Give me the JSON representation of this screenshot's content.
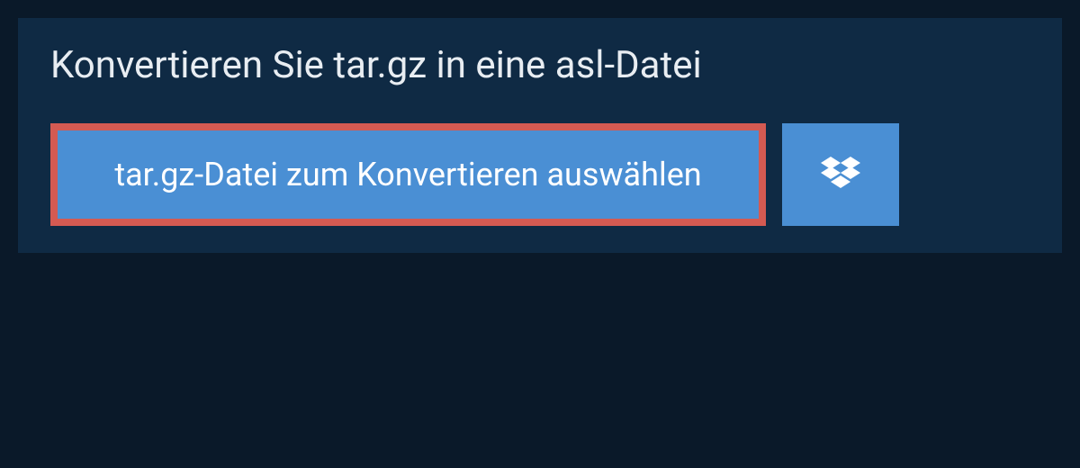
{
  "heading": "Konvertieren Sie tar.gz in eine asl-Datei",
  "selectButton": {
    "label": "tar.gz-Datei zum Konvertieren auswählen"
  },
  "colors": {
    "pageBg": "#0a1929",
    "panelBg": "#0f2a44",
    "buttonBg": "#4a8fd4",
    "highlightBorder": "#d45a52",
    "textLight": "#e8edf2",
    "textWhite": "#ffffff"
  }
}
